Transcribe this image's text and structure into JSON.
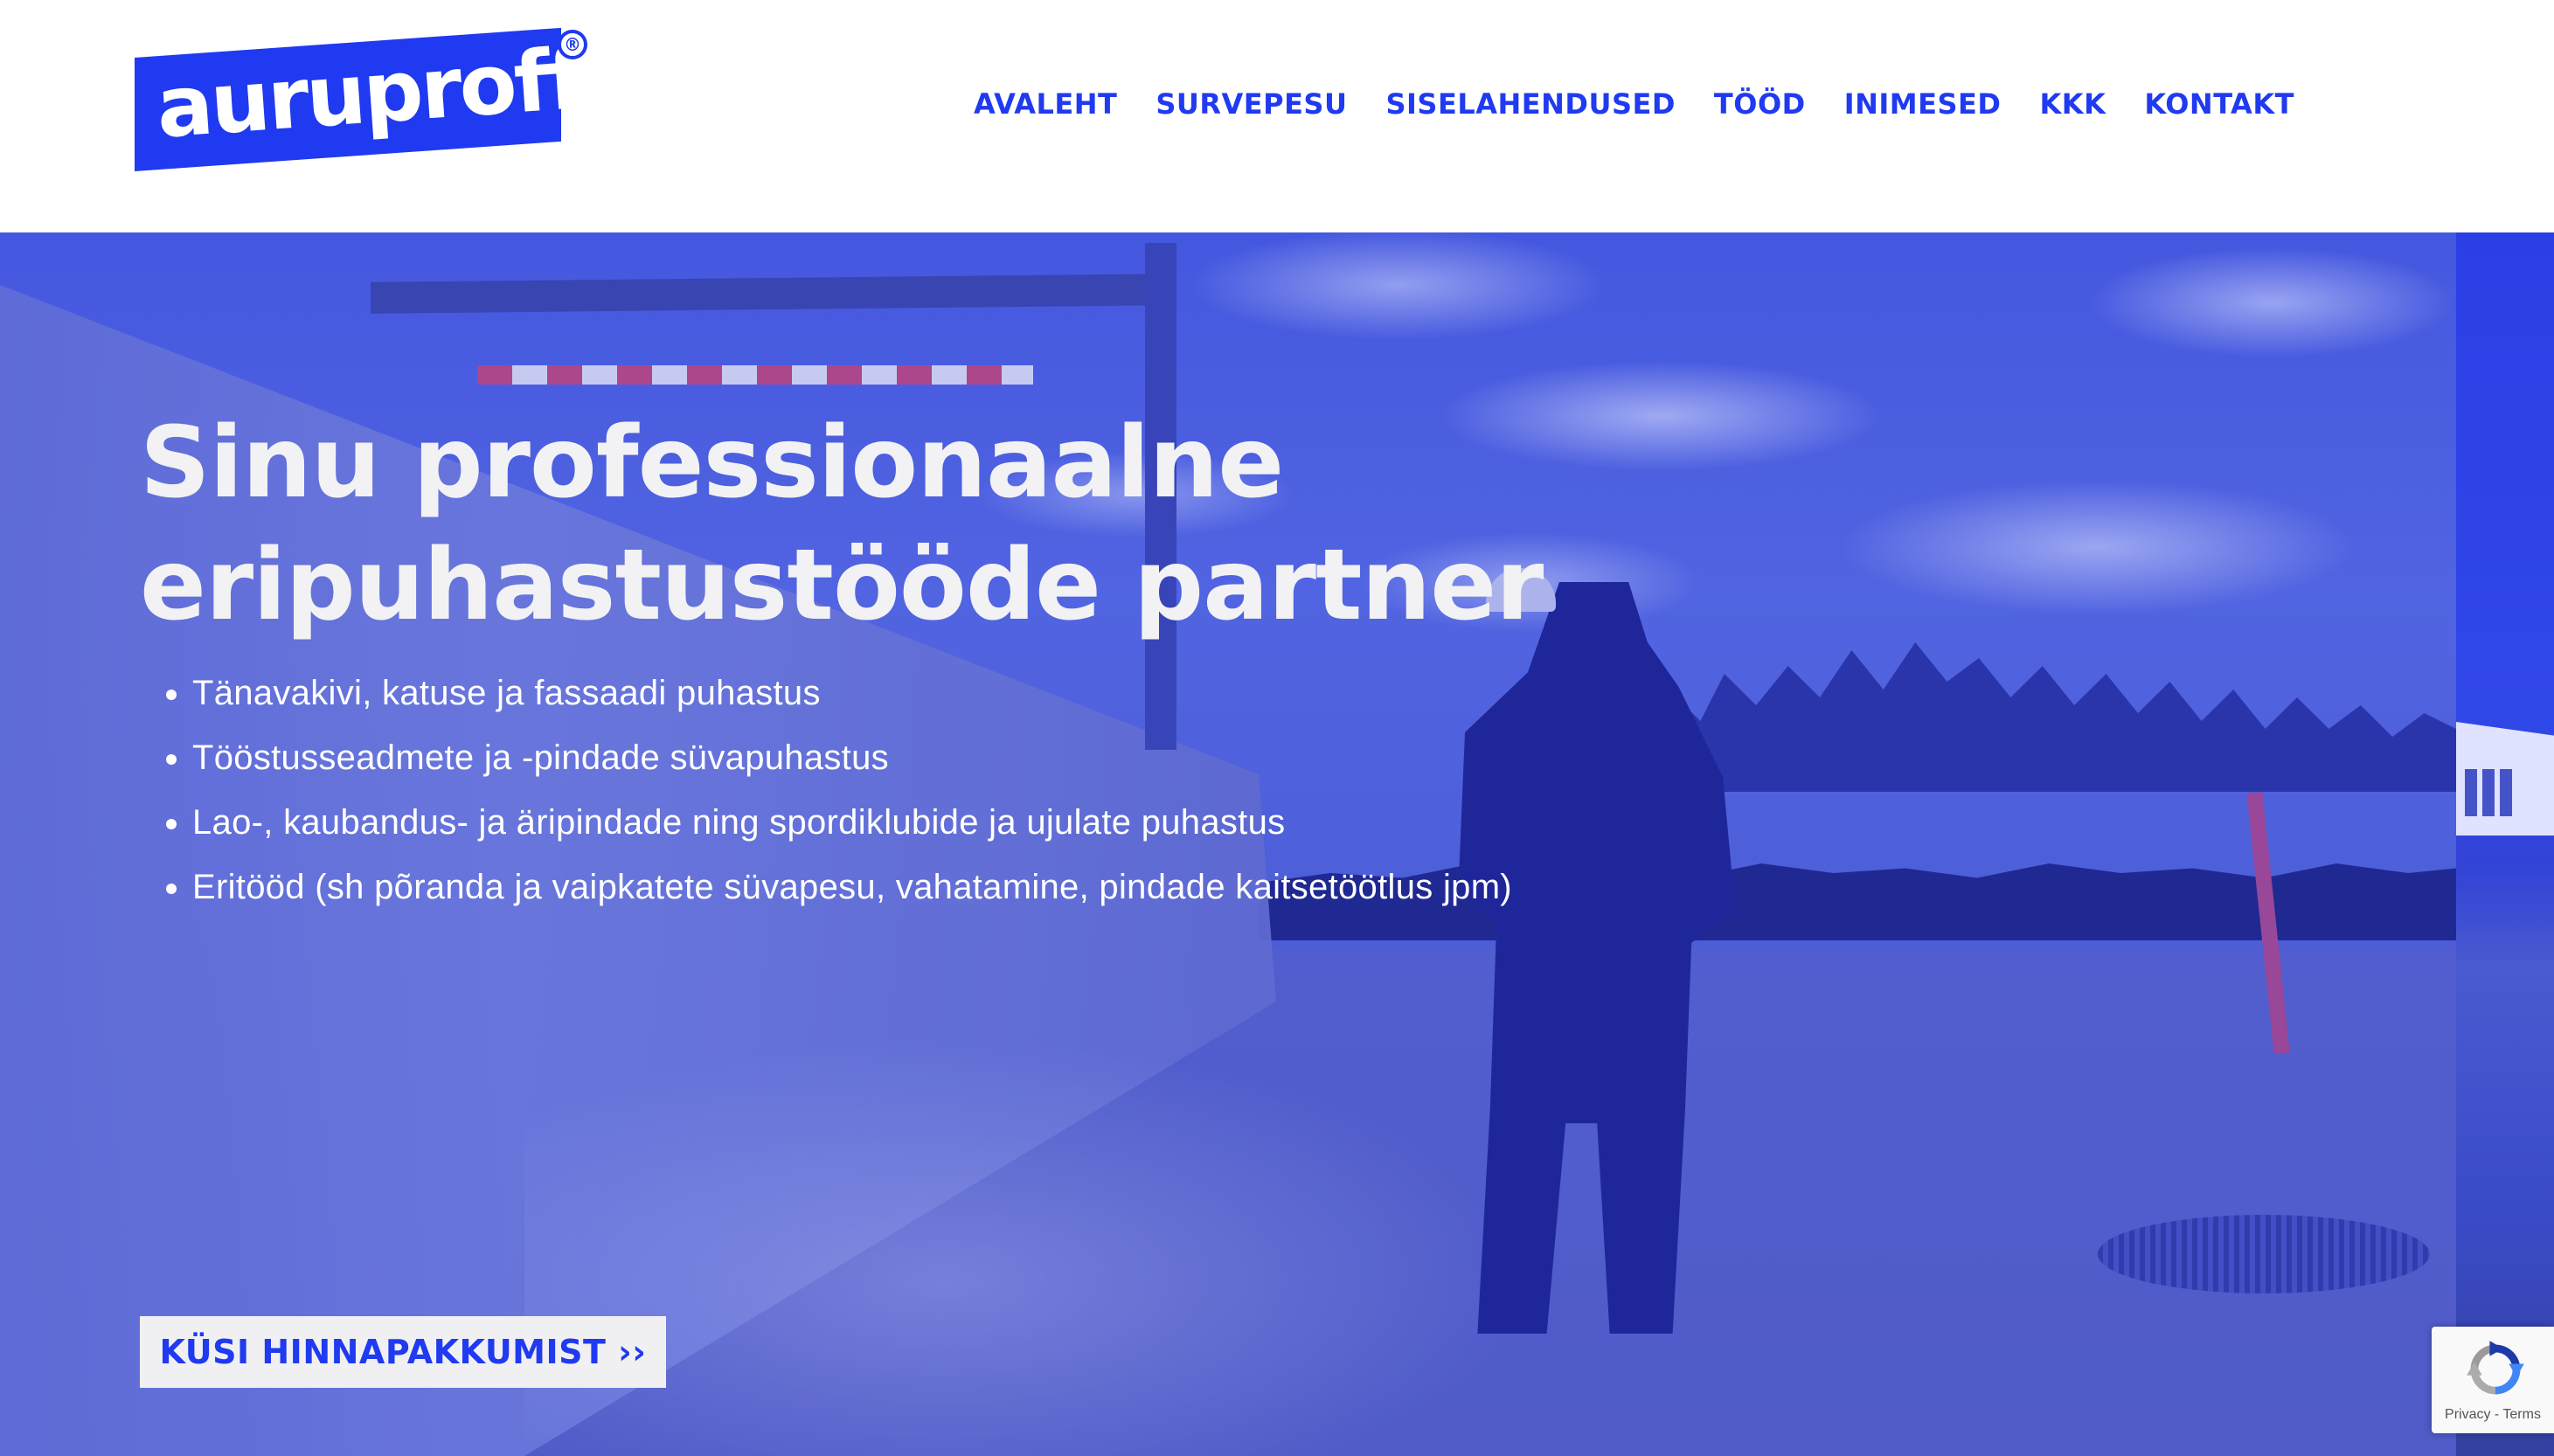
{
  "brand": {
    "logo_text": "auruproff",
    "registered_mark": "®",
    "primary_color": "#1f3af0"
  },
  "nav": {
    "items": [
      {
        "label": "AVALEHT"
      },
      {
        "label": "SURVEPESU"
      },
      {
        "label": "SISELAHENDUSED"
      },
      {
        "label": "TÖÖD"
      },
      {
        "label": "INIMESED"
      },
      {
        "label": "KKK"
      },
      {
        "label": "KONTAKT"
      }
    ]
  },
  "hero": {
    "title_line1": "Sinu professionaalne",
    "title_line2": "eripuhastustööde partner",
    "services": [
      "Tänavakivi, katuse ja fassaadi puhastus",
      "Tööstusseadmete ja -pindade süvapuhastus",
      "Lao-, kaubandus- ja äripindade ning spordiklubide ja ujulate puhastus",
      "Eritööd (sh põranda ja vaipkatete süvapesu, vahatamine, pindade kaitsetöötlus jpm)"
    ],
    "cta_label": "KÜSI HINNAPAKKUMIST ››",
    "image_icon": "pressure-washing-worker-photo"
  },
  "recaptcha": {
    "icon": "recaptcha-icon",
    "privacy_label": "Privacy",
    "separator": " - ",
    "terms_label": "Terms"
  }
}
